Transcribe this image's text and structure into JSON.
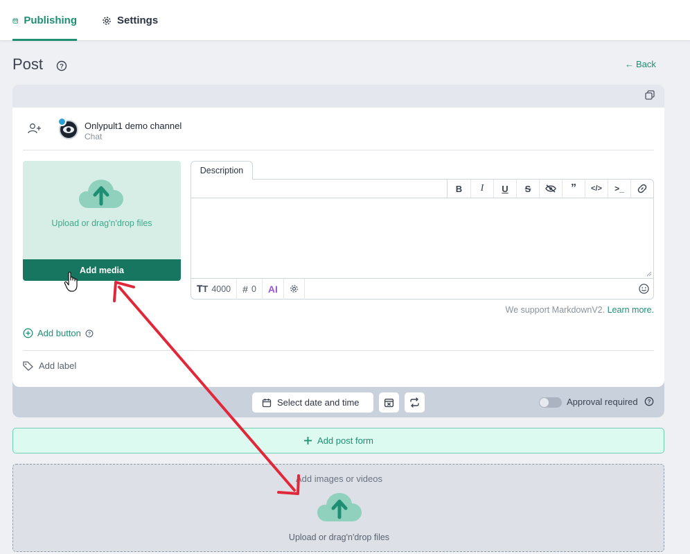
{
  "nav": {
    "tabs": [
      {
        "label": "Publishing",
        "icon": "calendar-icon",
        "active": true
      },
      {
        "label": "Settings",
        "icon": "gear-icon",
        "active": false
      }
    ]
  },
  "header": {
    "title": "Post",
    "back_label": "Back"
  },
  "channel": {
    "name": "Onlypult1 demo channel",
    "type": "Chat"
  },
  "media": {
    "upload_text": "Upload or drag'n'drop files",
    "add_media_label": "Add media"
  },
  "editor": {
    "tab_label": "Description",
    "format_buttons": [
      "bold",
      "italic",
      "underline",
      "strikethrough",
      "spoiler",
      "quote",
      "code",
      "code-block",
      "link"
    ],
    "char_limit": "4000",
    "hashtag_count": "0",
    "ai_label": "AI",
    "markdown_note": "We support MarkdownV2.",
    "learn_more": "Learn more."
  },
  "actions": {
    "add_button": "Add button",
    "add_label": "Add label"
  },
  "schedule": {
    "select_date_label": "Select date and time",
    "approval_label": "Approval required",
    "approval_enabled": false
  },
  "add_post_form": "Add post form",
  "dropzone": {
    "title": "Add images or videos",
    "text": "Upload or drag'n'drop files"
  },
  "colors": {
    "accent": "#1f8f73",
    "media_button": "#167660",
    "annotation_arrow": "#e0283a"
  }
}
